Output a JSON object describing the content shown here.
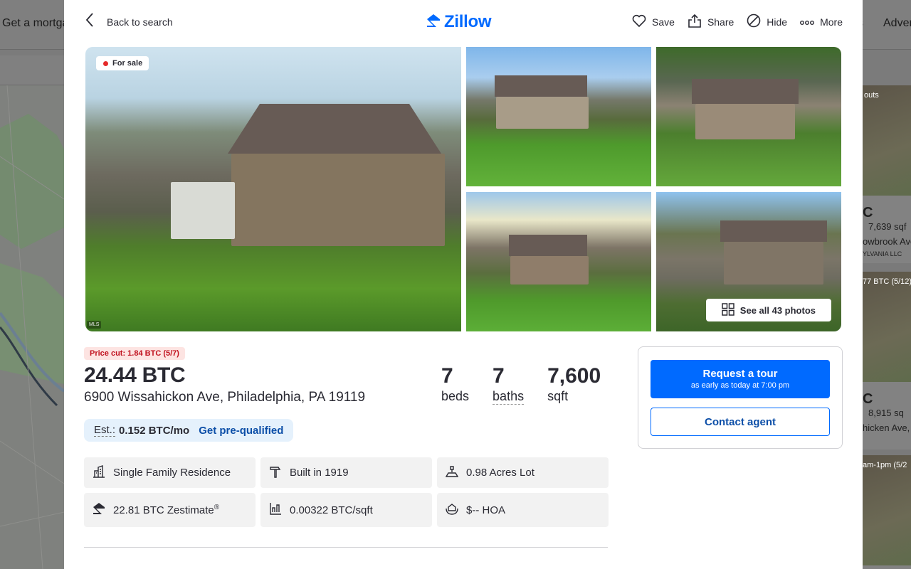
{
  "background": {
    "header_left": "Get a mortga",
    "header_right_partial": "s",
    "header_right": "Adver",
    "cards": [
      {
        "tag": "outs",
        "price": "C",
        "detail": "7,639 sqf",
        "address": "owbrook Ave",
        "broker": "YLVANIA LLC"
      },
      {
        "tag": "77 BTC (5/12)",
        "price": "C",
        "detail": "8,915 sq",
        "address": "hicken Ave,"
      },
      {
        "tag": "am-1pm (5/2"
      }
    ]
  },
  "topbar": {
    "back_label": "Back to search",
    "logo_text": "Zillow",
    "actions": [
      {
        "label": "Save",
        "icon": "heart-icon"
      },
      {
        "label": "Share",
        "icon": "share-icon"
      },
      {
        "label": "Hide",
        "icon": "hide-icon"
      },
      {
        "label": "More",
        "icon": "more-icon"
      }
    ]
  },
  "gallery": {
    "badge": "For sale",
    "mls_label": "MLS",
    "see_all": "See all 43 photos"
  },
  "listing": {
    "price_cut": "Price cut: 1.84 BTC (5/7)",
    "price": "24.44 BTC",
    "address": "6900 Wissahickon Ave, Philadelphia, PA 19119",
    "beds": {
      "value": "7",
      "label": "beds"
    },
    "baths": {
      "value": "7",
      "label": "baths"
    },
    "sqft": {
      "value": "7,600",
      "label": "sqft"
    },
    "est_label": "Est.:",
    "est_value": "0.152 BTC/mo",
    "prequal": "Get pre-qualified"
  },
  "facts": [
    {
      "icon": "building-icon",
      "text": "Single Family Residence"
    },
    {
      "icon": "hammer-icon",
      "text": "Built in 1919"
    },
    {
      "icon": "lot-icon",
      "text": "0.98 Acres Lot"
    },
    {
      "icon": "zestimate-icon",
      "text": "22.81 BTC Zestimate",
      "sup": "®"
    },
    {
      "icon": "price-per-sqft-icon",
      "text": "0.00322 BTC/sqft"
    },
    {
      "icon": "hoa-icon",
      "text": "$-- HOA"
    }
  ],
  "cta": {
    "tour_label": "Request a tour",
    "tour_sub": "as early as today at 7:00 pm",
    "contact_label": "Contact agent"
  },
  "colors": {
    "accent": "#006aff",
    "price_cut": "#c1121f",
    "est_bg": "#e5f1fc"
  }
}
